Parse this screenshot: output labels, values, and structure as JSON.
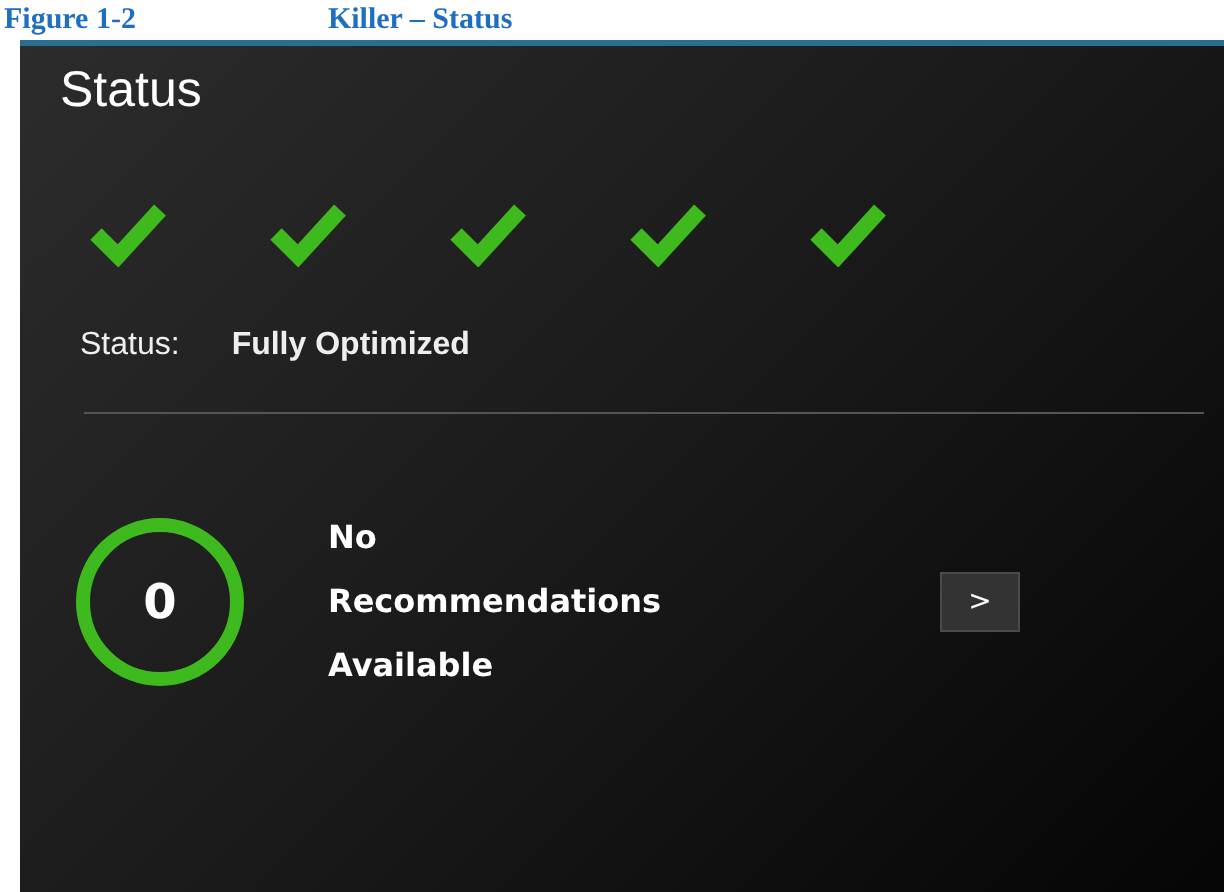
{
  "caption": {
    "number": "Figure 1-2",
    "title": "Killer – Status"
  },
  "panel": {
    "title": "Status",
    "checks": [
      {
        "checked": true
      },
      {
        "checked": true
      },
      {
        "checked": true
      },
      {
        "checked": true
      },
      {
        "checked": true
      }
    ],
    "status_label": "Status:",
    "status_value": "Fully Optimized",
    "recommendations": {
      "count": "0",
      "lines": [
        "No",
        "Recommendations",
        "Available"
      ],
      "button": ">"
    }
  }
}
